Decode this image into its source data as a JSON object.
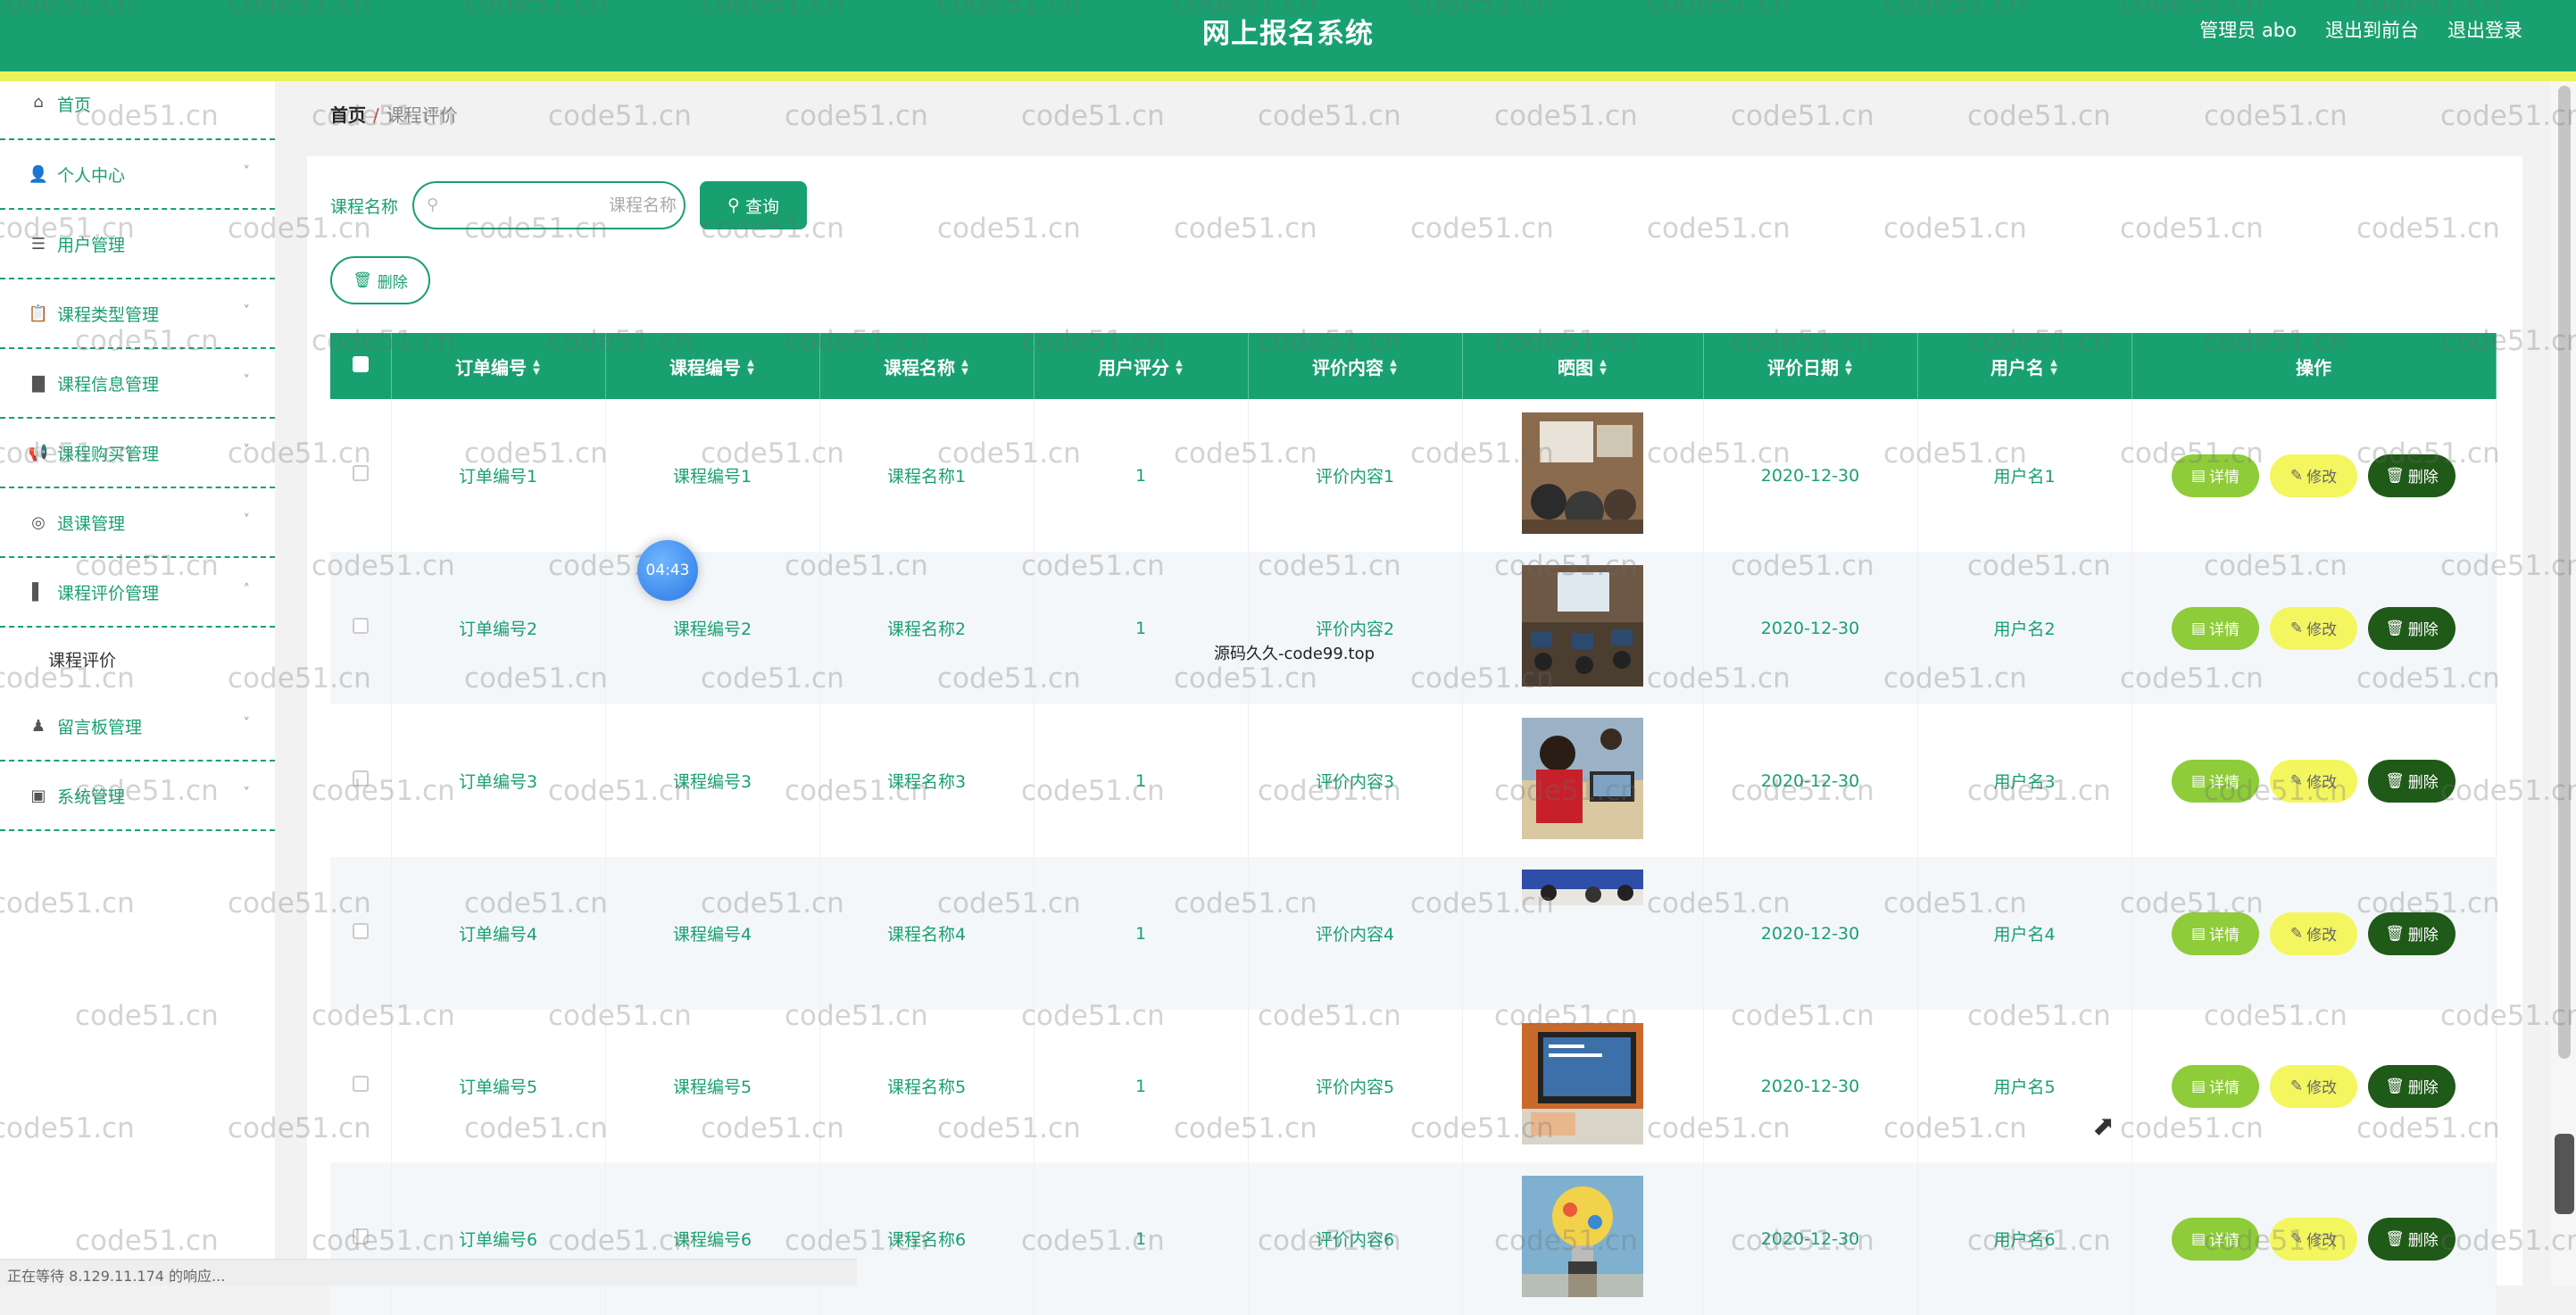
{
  "header": {
    "title": "网上报名系统",
    "admin": "管理员 abo",
    "exit_front": "退出到前台",
    "logout": "退出登录"
  },
  "sidebar": {
    "items": [
      {
        "label": "首页",
        "icon": "home-icon",
        "expandable": false
      },
      {
        "label": "个人中心",
        "icon": "user-icon",
        "expandable": true
      },
      {
        "label": "用户管理",
        "icon": "list-icon",
        "expandable": false
      },
      {
        "label": "课程类型管理",
        "icon": "clipboard-icon",
        "expandable": true
      },
      {
        "label": "课程信息管理",
        "icon": "stand-icon",
        "expandable": true
      },
      {
        "label": "课程购买管理",
        "icon": "megaphone-icon",
        "expandable": true
      },
      {
        "label": "退课管理",
        "icon": "compass-icon",
        "expandable": true
      },
      {
        "label": "课程评价管理",
        "icon": "bookmark-icon",
        "expandable": true,
        "expanded": true
      },
      {
        "label": "留言板管理",
        "icon": "stamp-icon",
        "expandable": true
      },
      {
        "label": "系统管理",
        "icon": "monitor-icon",
        "expandable": true
      }
    ],
    "subitem": "课程评价"
  },
  "breadcrumb": {
    "home": "首页",
    "separator": "/",
    "current": "课程评价"
  },
  "search": {
    "label": "课程名称",
    "placeholder": "课程名称",
    "value": "",
    "button": "查询"
  },
  "delete_button": "删除",
  "table": {
    "columns": [
      "订单编号",
      "课程编号",
      "课程名称",
      "用户评分",
      "评价内容",
      "晒图",
      "评价日期",
      "用户名",
      "操作"
    ],
    "sortable": [
      true,
      true,
      true,
      true,
      true,
      true,
      true,
      true,
      false
    ],
    "rows": [
      {
        "order": "订单编号1",
        "course_no": "课程编号1",
        "course_name": "课程名称1",
        "score": "1",
        "content": "评价内容1",
        "image": "classroom-photo",
        "date": "2020-12-30",
        "user": "用户名1"
      },
      {
        "order": "订单编号2",
        "course_no": "课程编号2",
        "course_name": "课程名称2",
        "score": "1",
        "content": "评价内容2",
        "image": "computer-lab-photo",
        "date": "2020-12-30",
        "user": "用户名2"
      },
      {
        "order": "订单编号3",
        "course_no": "课程编号3",
        "course_name": "课程名称3",
        "score": "1",
        "content": "评价内容3",
        "image": "student-photo",
        "date": "2020-12-30",
        "user": "用户名3"
      },
      {
        "order": "订单编号4",
        "course_no": "课程编号4",
        "course_name": "课程名称4",
        "score": "1",
        "content": "评价内容4",
        "image": "lecture-strip-photo",
        "date": "2020-12-30",
        "user": "用户名4"
      },
      {
        "order": "订单编号5",
        "course_no": "课程编号5",
        "course_name": "课程名称5",
        "score": "1",
        "content": "评价内容5",
        "image": "laptop-photo",
        "date": "2020-12-30",
        "user": "用户名5"
      },
      {
        "order": "订单编号6",
        "course_no": "课程编号6",
        "course_name": "课程名称6",
        "score": "1",
        "content": "评价内容6",
        "image": "lightbulb-photo",
        "date": "2020-12-30",
        "user": "用户名6"
      }
    ],
    "actions": {
      "detail": "详情",
      "edit": "修改",
      "remove": "删除"
    }
  },
  "overlay": {
    "timer": "04:43",
    "center_mark": "源码久久-code99.top",
    "watermark": "code51.cn",
    "status": "正在等待 8.129.11.174 的响应..."
  },
  "colors": {
    "primary": "#19a070",
    "accent_strip": "#e8f45a",
    "detail_btn": "#8fcc3a",
    "edit_btn": "#f4f660",
    "remove_btn": "#1f5a18"
  }
}
